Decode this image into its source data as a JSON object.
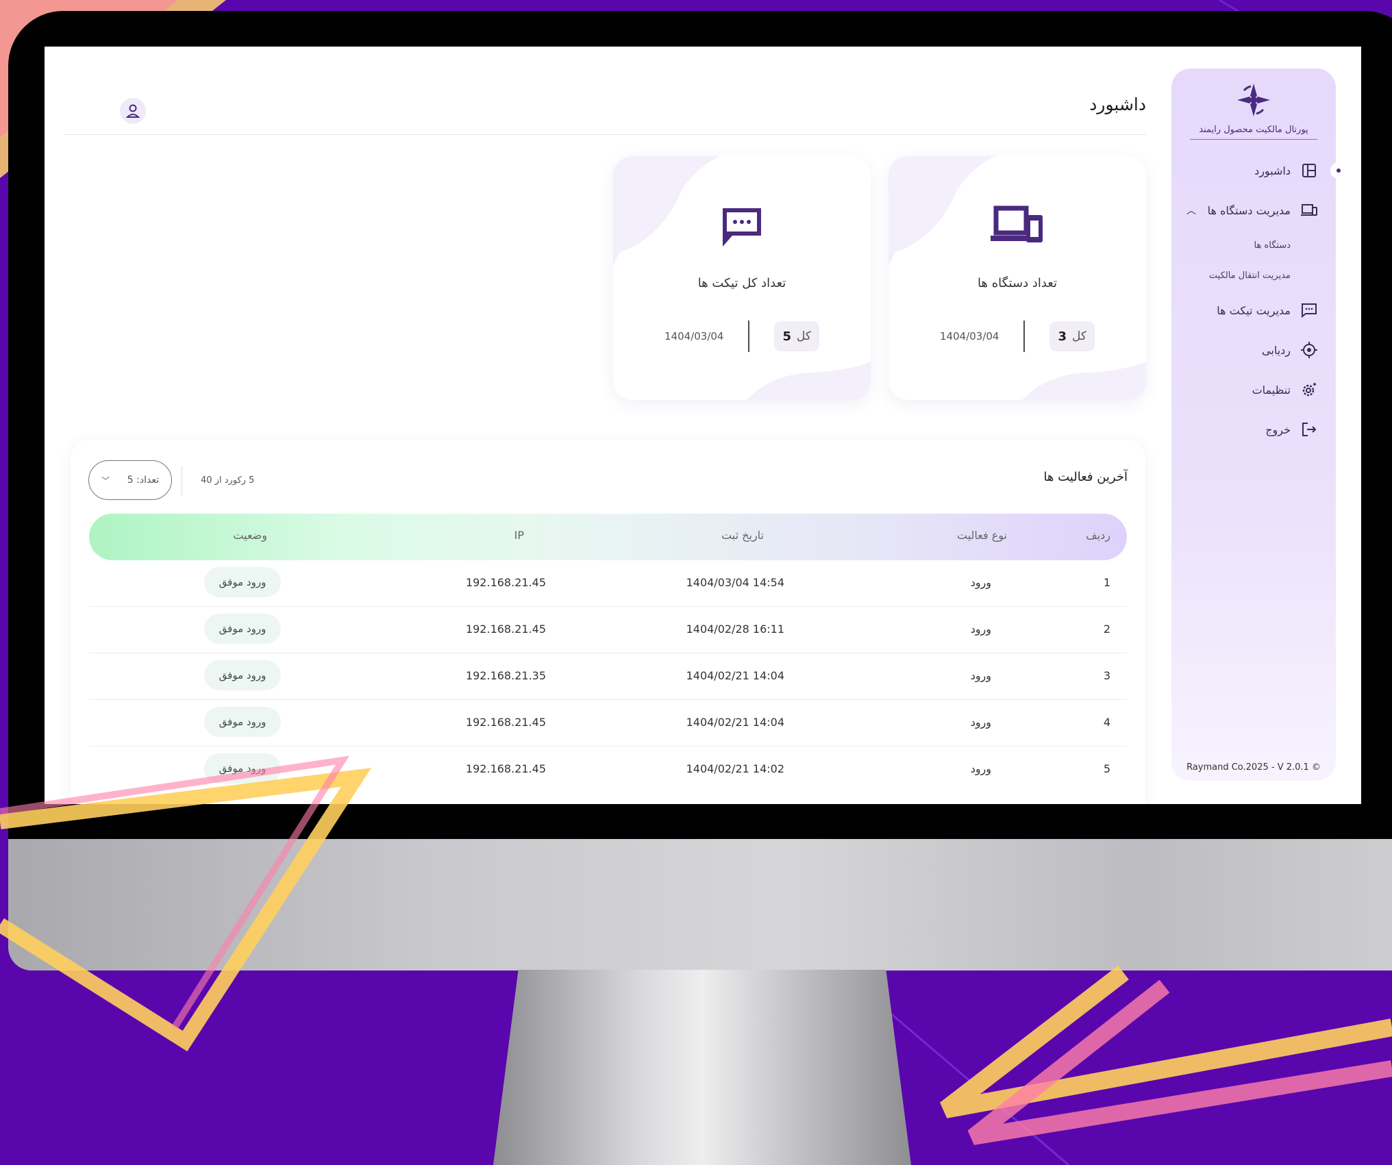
{
  "sidebar": {
    "logo_text": "پورتال مالکیت محصول رایمند",
    "items": [
      {
        "label": "داشبورد"
      },
      {
        "label": "مدیریت دستگاه ها"
      },
      {
        "label": "دستگاه ها"
      },
      {
        "label": "مدیریت انتقال مالکیت"
      },
      {
        "label": "مدیریت تیکت ها"
      },
      {
        "label": "ردیابی"
      },
      {
        "label": "تنظیمات"
      },
      {
        "label": "خروج"
      }
    ],
    "footer": "Raymand Co.2025 - V 2.0.1 ©"
  },
  "header": {
    "title": "داشبورد"
  },
  "cards": [
    {
      "title": "تعداد دستگاه ها",
      "total_label": "کل",
      "total_value": "3",
      "date": "1404/03/04",
      "icon": "devices-icon"
    },
    {
      "title": "تعداد کل تیکت ها",
      "total_label": "کل",
      "total_value": "5",
      "date": "1404/03/04",
      "icon": "chat-icon"
    }
  ],
  "activity": {
    "title": "آخرین فعالیت ها",
    "records_text": "5 رکورد از 40",
    "count_select": "تعداد: 5",
    "columns": [
      "ردیف",
      "نوع فعالیت",
      "تاریخ ثبت",
      "IP",
      "وضعیت"
    ],
    "rows": [
      {
        "index": "1",
        "type": "ورود",
        "date": "1404/03/04 14:54",
        "ip": "192.168.21.45",
        "status": "ورود موفق"
      },
      {
        "index": "2",
        "type": "ورود",
        "date": "1404/02/28 16:11",
        "ip": "192.168.21.45",
        "status": "ورود موفق"
      },
      {
        "index": "3",
        "type": "ورود",
        "date": "1404/02/21 14:04",
        "ip": "192.168.21.35",
        "status": "ورود موفق"
      },
      {
        "index": "4",
        "type": "ورود",
        "date": "1404/02/21 14:04",
        "ip": "192.168.21.45",
        "status": "ورود موفق"
      },
      {
        "index": "5",
        "type": "ورود",
        "date": "1404/02/21 14:02",
        "ip": "192.168.21.45",
        "status": "ورود موفق"
      }
    ]
  },
  "colors": {
    "background": "#5a06ad",
    "accent": "#4a2a7e",
    "sidebar": "#e6d9fb"
  }
}
